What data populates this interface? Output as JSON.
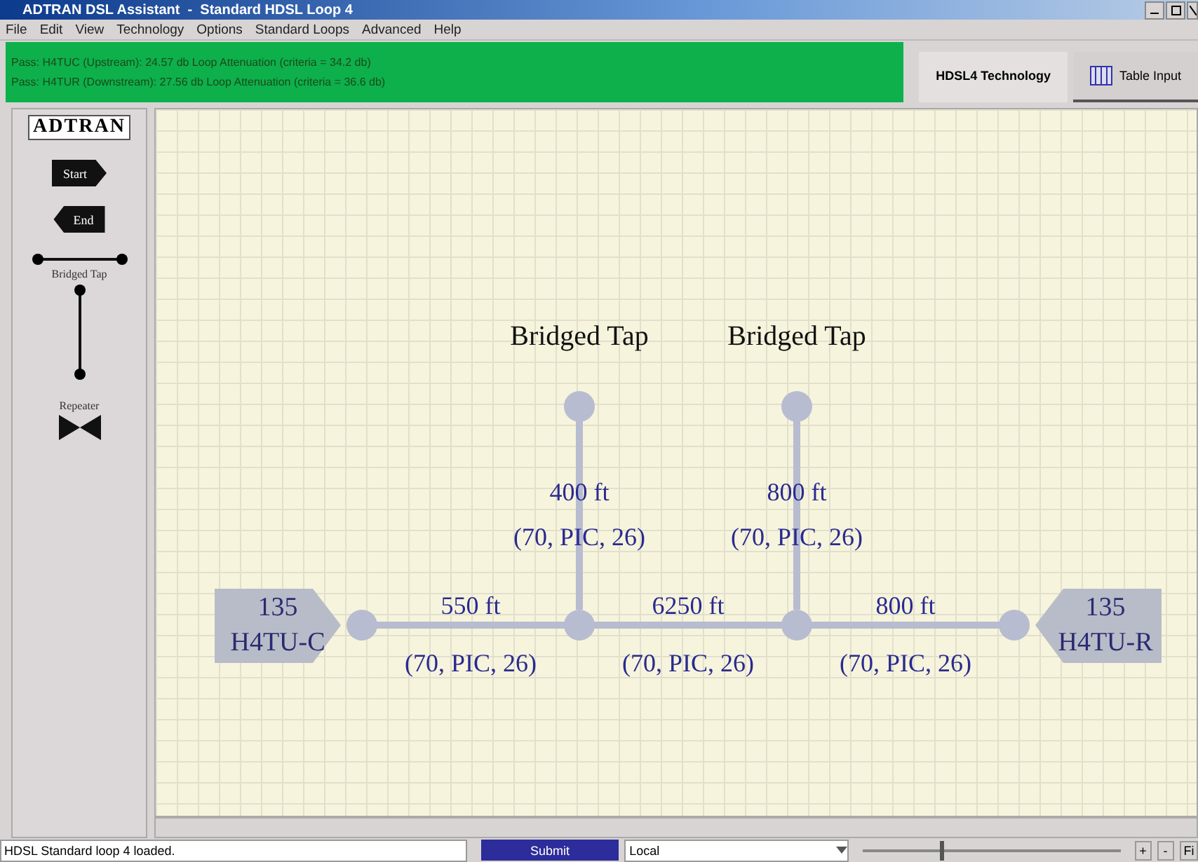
{
  "window": {
    "title": "ADTRAN DSL Assistant  -  Standard HDSL Loop 4"
  },
  "menu": [
    "File",
    "Edit",
    "View",
    "Technology",
    "Options",
    "Standard Loops",
    "Advanced",
    "Help"
  ],
  "results": [
    {
      "text": "Pass: H4TUC (Upstream): 24.57 db Loop Attenuation (criteria = 34.2 db)",
      "passed": true
    },
    {
      "text": "Pass: H4TUR (Downstream): 27.56 db Loop Attenuation (criteria = 36.6 db)",
      "passed": true
    }
  ],
  "tabs": [
    {
      "label": "HDSL4 Technology",
      "selected": true,
      "kind": "text"
    },
    {
      "label": "Table Input",
      "selected": false,
      "kind": "table"
    }
  ],
  "palette": {
    "logo": "ADTRAN",
    "items": [
      {
        "kind": "start",
        "label": "Start"
      },
      {
        "kind": "end",
        "label": "End"
      },
      {
        "kind": "tap",
        "label": "Bridged Tap"
      },
      {
        "kind": "repeater",
        "label": "Repeater"
      }
    ]
  },
  "diagram": {
    "ends": [
      {
        "number": "135",
        "unit": "H4TU-C"
      },
      {
        "number": "135",
        "unit": "H4TU-R"
      }
    ],
    "segments": [
      {
        "length": "550 ft",
        "cable": "(70, PIC, 26)"
      },
      {
        "length": "6250 ft",
        "cable": "(70, PIC, 26)"
      },
      {
        "length": "800 ft",
        "cable": "(70, PIC, 26)"
      }
    ],
    "taps": [
      {
        "title": "Bridged Tap",
        "length": "400 ft",
        "cable": "(70, PIC, 26)"
      },
      {
        "title": "Bridged Tap",
        "length": "800 ft",
        "cable": "(70, PIC, 26)"
      }
    ]
  },
  "status_bar": {
    "message": "HDSL Standard loop 4 loaded.",
    "button": "Submit",
    "mode": "Local",
    "zoom": {
      "level": 0.3
    },
    "plus": "+",
    "minus": "-",
    "fit": "Fi"
  }
}
